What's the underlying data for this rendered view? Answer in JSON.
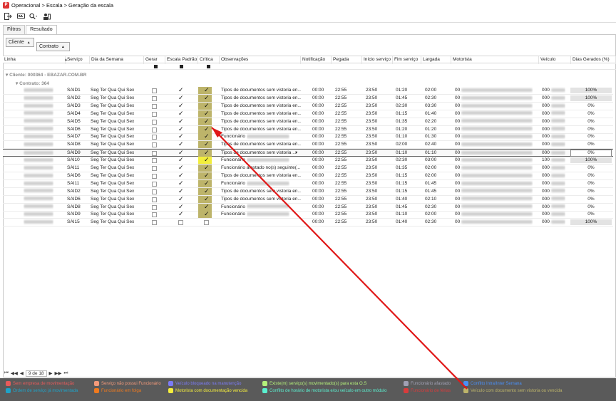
{
  "window": {
    "breadcrumb": "Operacional > Escala > Geração da escala",
    "app_icon": "app-logo-icon"
  },
  "toolbar": {
    "icons": [
      "exit-icon",
      "screen-icon",
      "search-icon",
      "users-icon"
    ]
  },
  "tabs": [
    {
      "label": "Filtros",
      "active": false
    },
    {
      "label": "Resultado",
      "active": true
    }
  ],
  "filters": {
    "cliente_label": "Cliente",
    "contrato_label": "Contrato"
  },
  "columns": [
    "Linha",
    "Serviço",
    "Dia da Semana",
    "Gerar",
    "Escala Padrão",
    "Crítica",
    "Observações",
    "Notificação",
    "Pegada",
    "Início serviço",
    "Fim serviço",
    "Largada",
    "Motorista",
    "Veículo",
    "Dias Gerados (%)"
  ],
  "groups": {
    "cliente": "Cliente: 000364 - EBAZAR.COM.BR",
    "contrato": "Contrato: 364"
  },
  "rows": [
    {
      "servico": "SAID1",
      "dia": "Seg Ter Qua Qui Sex",
      "gerar": false,
      "escala": true,
      "critica": true,
      "crit_color": "olive",
      "obs": "Tipos de documentos sem vistoria en...",
      "notif": "00:00",
      "pegada": "22:55",
      "inicio": "23:50",
      "fim": "01:20",
      "largada": "02:00",
      "motorista": "00",
      "veiculo": "000",
      "pct": "100%",
      "pct_bg": true
    },
    {
      "servico": "SAID2",
      "dia": "Seg Ter Qua Qui Sex",
      "gerar": false,
      "escala": true,
      "critica": true,
      "crit_color": "olive",
      "obs": "Tipos de documentos sem vistoria en...",
      "notif": "00:00",
      "pegada": "22:55",
      "inicio": "23:50",
      "fim": "01:45",
      "largada": "02:30",
      "motorista": "00",
      "veiculo": "000",
      "pct": "100%",
      "pct_bg": true
    },
    {
      "servico": "SAID3",
      "dia": "Seg Ter Qua Qui Sex",
      "gerar": false,
      "escala": true,
      "critica": true,
      "crit_color": "olive",
      "obs": "Tipos de documentos sem vistoria en...",
      "notif": "00:00",
      "pegada": "22:55",
      "inicio": "23:50",
      "fim": "02:30",
      "largada": "03:30",
      "motorista": "00",
      "veiculo": "000",
      "pct": "0%",
      "pct_bg": false
    },
    {
      "servico": "SAID4",
      "dia": "Seg Ter Qua Qui Sex",
      "gerar": false,
      "escala": true,
      "critica": true,
      "crit_color": "olive",
      "obs": "Tipos de documentos sem vistoria en...",
      "notif": "00:00",
      "pegada": "22:55",
      "inicio": "23:50",
      "fim": "01:15",
      "largada": "01:40",
      "motorista": "00",
      "veiculo": "000",
      "pct": "0%",
      "pct_bg": false
    },
    {
      "servico": "SAID5",
      "dia": "Seg Ter Qua Qui Sex",
      "gerar": false,
      "escala": true,
      "critica": true,
      "crit_color": "olive",
      "obs": "Tipos de documentos sem vistoria en...",
      "notif": "00:00",
      "pegada": "22:55",
      "inicio": "23:50",
      "fim": "01:35",
      "largada": "02:20",
      "motorista": "00",
      "veiculo": "000",
      "pct": "0%",
      "pct_bg": false
    },
    {
      "servico": "SAID6",
      "dia": "Seg Ter Qua Qui Sex",
      "gerar": false,
      "escala": true,
      "critica": true,
      "crit_color": "olive",
      "obs": "Tipos de documentos sem vistoria en...",
      "notif": "00:00",
      "pegada": "22:55",
      "inicio": "23:50",
      "fim": "01:20",
      "largada": "01:20",
      "motorista": "00",
      "veiculo": "000",
      "pct": "0%",
      "pct_bg": false
    },
    {
      "servico": "SAID7",
      "dia": "Seg Ter Qua Qui Sex",
      "gerar": false,
      "escala": true,
      "critica": true,
      "crit_color": "olive",
      "obs": "Funcionário",
      "notif": "00:00",
      "pegada": "22:55",
      "inicio": "23:50",
      "fim": "01:10",
      "largada": "01:30",
      "motorista": "00",
      "veiculo": "000",
      "pct": "0%",
      "pct_bg": false
    },
    {
      "servico": "SAID8",
      "dia": "Seg Ter Qua Qui Sex",
      "gerar": false,
      "escala": true,
      "critica": true,
      "crit_color": "olive",
      "obs": "Tipos de documentos sem vistoria en...",
      "notif": "00:00",
      "pegada": "22:55",
      "inicio": "23:50",
      "fim": "02:00",
      "largada": "02:40",
      "motorista": "00",
      "veiculo": "000",
      "pct": "0%",
      "pct_bg": false
    },
    {
      "servico": "SAID9",
      "dia": "Seg Ter Qua Qui Sex",
      "gerar": false,
      "escala": true,
      "critica": true,
      "crit_color": "olive",
      "obs": "Tipos de documentos sem vistoria ...",
      "notif": "00:00",
      "pegada": "22:55",
      "inicio": "23:50",
      "fim": "01:10",
      "largada": "01:10",
      "motorista": "00",
      "veiculo": "000",
      "pct": "0%",
      "pct_bg": false,
      "selected": true
    },
    {
      "servico": "SAI10",
      "dia": "Seg Ter Qua Qui Sex",
      "gerar": false,
      "escala": true,
      "critica": true,
      "crit_color": "yellow",
      "obs": "Funcionário",
      "notif": "00:00",
      "pegada": "22:55",
      "inicio": "23:50",
      "fim": "02:30",
      "largada": "03:00",
      "motorista": "00",
      "veiculo": "100",
      "pct": "100%",
      "pct_bg": true
    },
    {
      "servico": "SAI11",
      "dia": "Seg Ter Qua Qui Sex",
      "gerar": false,
      "escala": true,
      "critica": true,
      "crit_color": "olive",
      "obs": "Funcionário afastado no(s) seguinte(...",
      "notif": "00:00",
      "pegada": "22:55",
      "inicio": "23:50",
      "fim": "01:35",
      "largada": "02:00",
      "motorista": "00",
      "veiculo": "000",
      "pct": "0%",
      "pct_bg": false
    },
    {
      "servico": "SAID6",
      "dia": "Seg Ter Qua Qui Sex",
      "gerar": false,
      "escala": true,
      "critica": true,
      "crit_color": "olive",
      "obs": "Tipos de documentos sem vistoria en...",
      "notif": "00:00",
      "pegada": "22:55",
      "inicio": "23:50",
      "fim": "01:15",
      "largada": "02:00",
      "motorista": "00",
      "veiculo": "000",
      "pct": "0%",
      "pct_bg": false
    },
    {
      "servico": "SAI11",
      "dia": "Seg Ter Qua Qui Sex",
      "gerar": false,
      "escala": true,
      "critica": true,
      "crit_color": "olive",
      "obs": "Funcionário",
      "notif": "00:00",
      "pegada": "22:55",
      "inicio": "23:50",
      "fim": "01:15",
      "largada": "01:45",
      "motorista": "00",
      "veiculo": "000",
      "pct": "0%",
      "pct_bg": false
    },
    {
      "servico": "SAID2",
      "dia": "Seg Ter Qua Qui Sex",
      "gerar": false,
      "escala": true,
      "critica": true,
      "crit_color": "olive",
      "obs": "Tipos de documentos sem vistoria en...",
      "notif": "00:00",
      "pegada": "22:55",
      "inicio": "23:50",
      "fim": "01:15",
      "largada": "01:45",
      "motorista": "00",
      "veiculo": "000",
      "pct": "0%",
      "pct_bg": false
    },
    {
      "servico": "SAID6",
      "dia": "Seg Ter Qua Qui Sex",
      "gerar": false,
      "escala": true,
      "critica": true,
      "crit_color": "olive",
      "obs": "Tipos de documentos sem vistoria en...",
      "notif": "00:00",
      "pegada": "22:55",
      "inicio": "23:50",
      "fim": "01:40",
      "largada": "02:10",
      "motorista": "00",
      "veiculo": "000",
      "pct": "0%",
      "pct_bg": false
    },
    {
      "servico": "SAID8",
      "dia": "Seg Ter Qua Qui Sex",
      "gerar": false,
      "escala": true,
      "critica": true,
      "crit_color": "olive",
      "obs": "Funcionário",
      "notif": "00:00",
      "pegada": "22:55",
      "inicio": "23:50",
      "fim": "01:45",
      "largada": "02:30",
      "motorista": "00",
      "veiculo": "000",
      "pct": "0%",
      "pct_bg": false
    },
    {
      "servico": "SAID9",
      "dia": "Seg Ter Qua Qui Sex",
      "gerar": false,
      "escala": true,
      "critica": true,
      "crit_color": "olive",
      "obs": "Funcionário",
      "notif": "00:00",
      "pegada": "22:55",
      "inicio": "23:50",
      "fim": "01:10",
      "largada": "02:00",
      "motorista": "00",
      "veiculo": "000",
      "pct": "0%",
      "pct_bg": false
    },
    {
      "servico": "SAI15",
      "dia": "Seg Ter Qua Qui Sex",
      "gerar": false,
      "escala": false,
      "critica": false,
      "crit_color": "none",
      "obs": "",
      "notif": "00:00",
      "pegada": "22:55",
      "inicio": "23:50",
      "fim": "01:40",
      "largada": "02:30",
      "motorista": "00",
      "veiculo": "000",
      "pct": "100%",
      "pct_bg": true
    }
  ],
  "pager": {
    "text": "9 de 18"
  },
  "legend": [
    {
      "label": "Sem empresa de movimentação",
      "color": "#e85a5a"
    },
    {
      "label": "Serviço não possui Funcionário",
      "color": "#f39a7a"
    },
    {
      "label": "Veículo bloqueado na manutenção",
      "color": "#7b7bf5"
    },
    {
      "label": "Existe(m) serviço(s) movimentado(s) para esta O.S",
      "color": "#b4f07a"
    },
    {
      "label": "Funcionário afastado",
      "color": "#a0a0b4"
    },
    {
      "label": "Conflito Intra/Inter Semana",
      "color": "#4a8ff5"
    },
    {
      "label": "Ordem de serviço já movimentada",
      "color": "#1ea3c8"
    },
    {
      "label": "Funcionário em folga",
      "color": "#f07a1e"
    },
    {
      "label": "Motorista com documentação vencida",
      "color": "#f5ee3c"
    },
    {
      "label": "Conflito de horário de motorista e/ou veículo em outro módulo",
      "color": "#5af0d0"
    },
    {
      "label": "Funcionário de férias",
      "color": "#d83c3c"
    },
    {
      "label": "Veículo com documento sem vistoria ou vencida",
      "color": "#bdb46a"
    }
  ]
}
